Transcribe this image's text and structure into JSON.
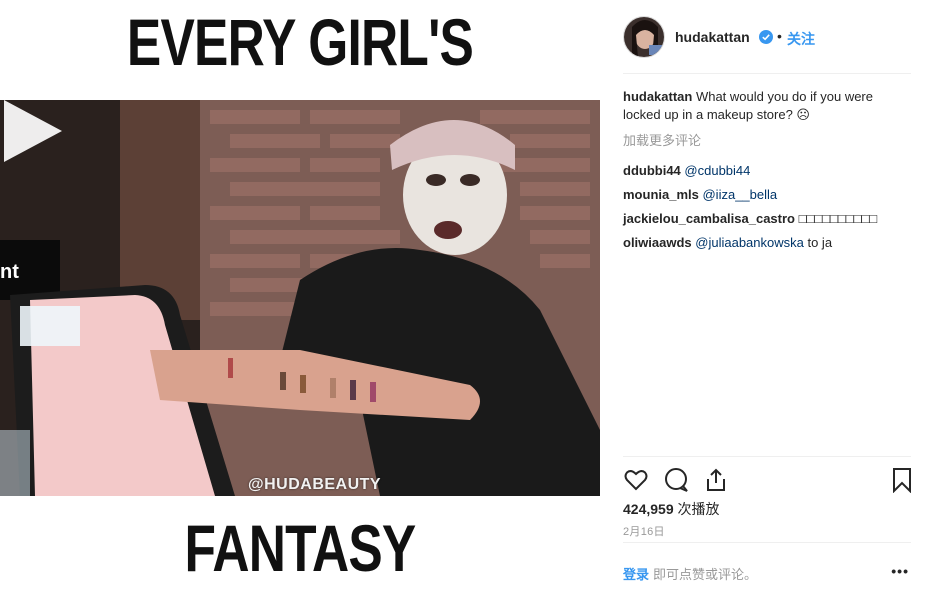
{
  "media": {
    "headline_top": "EVERY GIRL'S",
    "headline_bottom": "FANTASY",
    "watermark": "@HUDABEAUTY",
    "play_icon": "play-icon"
  },
  "post": {
    "owner": "hudakattan",
    "verified_icon": "verified-badge-icon",
    "separator": "•",
    "follow_label": "关注",
    "caption_user": "hudakattan",
    "caption_text": " What would you do if you were locked up in a makeup store? ☹",
    "load_more": "加载更多评论",
    "comments": [
      {
        "user": "ddubbi44",
        "text": "@cdubbi44",
        "is_mention": true
      },
      {
        "user": "mounia_mls",
        "text": "@iiza__bella",
        "is_mention": true
      },
      {
        "user": "jackielou_cambalisa_castro",
        "text": "□□□□□□□□□□",
        "is_mention": false
      },
      {
        "user": "oliwiaawds",
        "text": "@juliaabankowska",
        "suffix": " to ja",
        "is_mention": true
      }
    ],
    "views_count": "424,959",
    "views_label": " 次播放",
    "date": "2月16日",
    "login_label": "登录",
    "login_rest": " 即可点赞或评论。",
    "more_label": "•••"
  },
  "colors": {
    "accent": "#3897f0",
    "mention": "#003569",
    "muted": "#999999"
  }
}
